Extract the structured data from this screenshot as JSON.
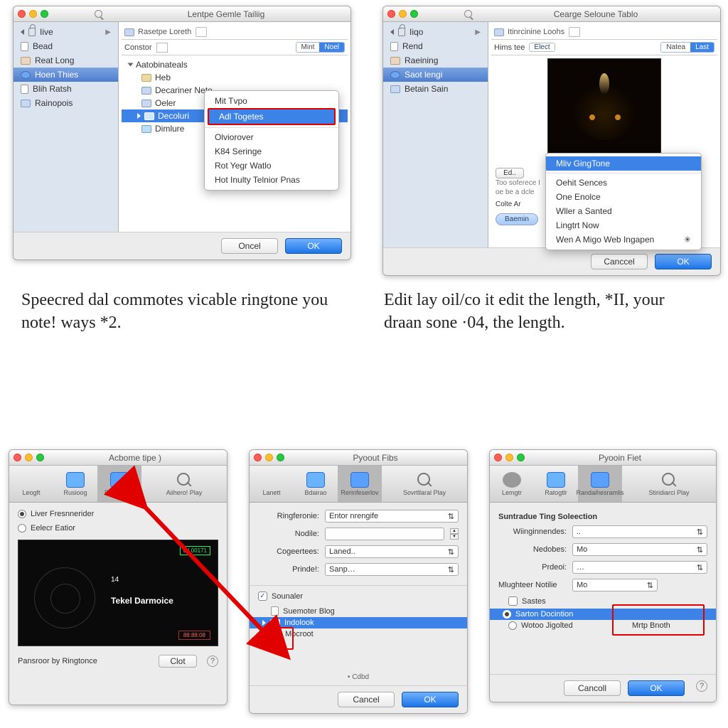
{
  "panel1": {
    "title": "Lentpe Gemle Tailiig",
    "sidebar": [
      "Iive",
      "Bead",
      "Reat Long",
      "Hoen Thies",
      "Blih Ratsh",
      "Rainopois"
    ],
    "sidebar_sel": 3,
    "crumb_label": "Rasetpe Loreth",
    "constor": "Constor",
    "seg": [
      "Mint",
      "Noel"
    ],
    "tree_root": "Aatobinateals",
    "tree_items": [
      "Heb",
      "Decariner Neto",
      "Oeler",
      "Decoluri",
      "Dimlure"
    ],
    "ctx": [
      "Mit Tvpo",
      "Adl Togetes",
      "Olviorover",
      "K84 Seringe",
      "Rot Yegr Watlo",
      "Hot Inulty Telnior Pnas"
    ],
    "cancel": "Oncel",
    "ok": "OK"
  },
  "panel2": {
    "title": "Cearge Seloune Tablo",
    "sidebar": [
      "Iiqo",
      "Rend",
      "Raeining",
      "Saot lengi",
      "Betain Sain"
    ],
    "sidebar_sel": 3,
    "crumb_label": "Itinrcinine Loohs",
    "constor": "Hims tee",
    "seg_mid": "Elect",
    "seg": [
      "Natea",
      "Last"
    ],
    "edit_btn": "Ed..",
    "desc1": "Too soferece I",
    "desc2": "oe be a dcle",
    "desc3": "Colte Ar",
    "browse_btn": "Baemin",
    "ctx": [
      "Mliv GingTone",
      "Oehit Sences",
      "One Enolce",
      "Wller a Santed",
      "Lingtrt Now",
      "Wen A Migo Web Ingapen"
    ],
    "cancel": "Canccel",
    "ok": "OK"
  },
  "cap1": "Speecred dal commotes vicable ringtone you note! ways *2.",
  "cap2": "Edit lay oil/co it edit the length, *II, your draan sone ·04, the length.",
  "panel3": {
    "title": "Acbome tipe )",
    "tb": [
      "Leogft",
      "Rusioog",
      "Rurslecioc",
      "Aiihero! Play"
    ],
    "r1": "Liver Fresnnerider",
    "r2": "Eelecr Eatior",
    "num": "14",
    "center": "Tekel Darmoice",
    "foot": "Pansroor by Ringtonce",
    "clot": "Clot"
  },
  "panel4": {
    "title": "Pyoout Fibs",
    "tb": [
      "Lanett",
      "Bdairao",
      "Rerinfeserlov",
      "Sovrtllaral Play"
    ],
    "rows": [
      {
        "l": "Ringferonie:",
        "v": "Entor nrengife"
      },
      {
        "l": "Nodile:",
        "v": ""
      },
      {
        "l": "Cogeertees:",
        "v": "Laned.."
      },
      {
        "l": "Prinde!:",
        "v": "Sanp…"
      }
    ],
    "chk": "Sounaler",
    "list": [
      "Suemoter Blog",
      "Indolook",
      "Mocroot"
    ],
    "cdbd": "Cdbd",
    "cancel": "Cancel",
    "ok": "OK"
  },
  "panel5": {
    "title": "Pyooin Fiet",
    "tb": [
      "Lemgtr",
      "Ratogtlr",
      "Randaihesramlis",
      "Stiridiarci Play"
    ],
    "sec": "Suntradue Ting Soleection",
    "rows": [
      {
        "l": "Wiinginnendes:",
        "v": ".."
      },
      {
        "l": "Nedobes:",
        "v": "Mo"
      },
      {
        "l": "Prdeoi:",
        "v": "…"
      }
    ],
    "not_l": "Mlughteer Notilie",
    "not_v": "Mo",
    "chk": "Sastes",
    "opt1": "Sarton Docintion",
    "opt2": "Wotoo Jigolted",
    "opt2v": "Mrtp Bnoth",
    "cancel": "Cancoll",
    "ok": "OK"
  }
}
